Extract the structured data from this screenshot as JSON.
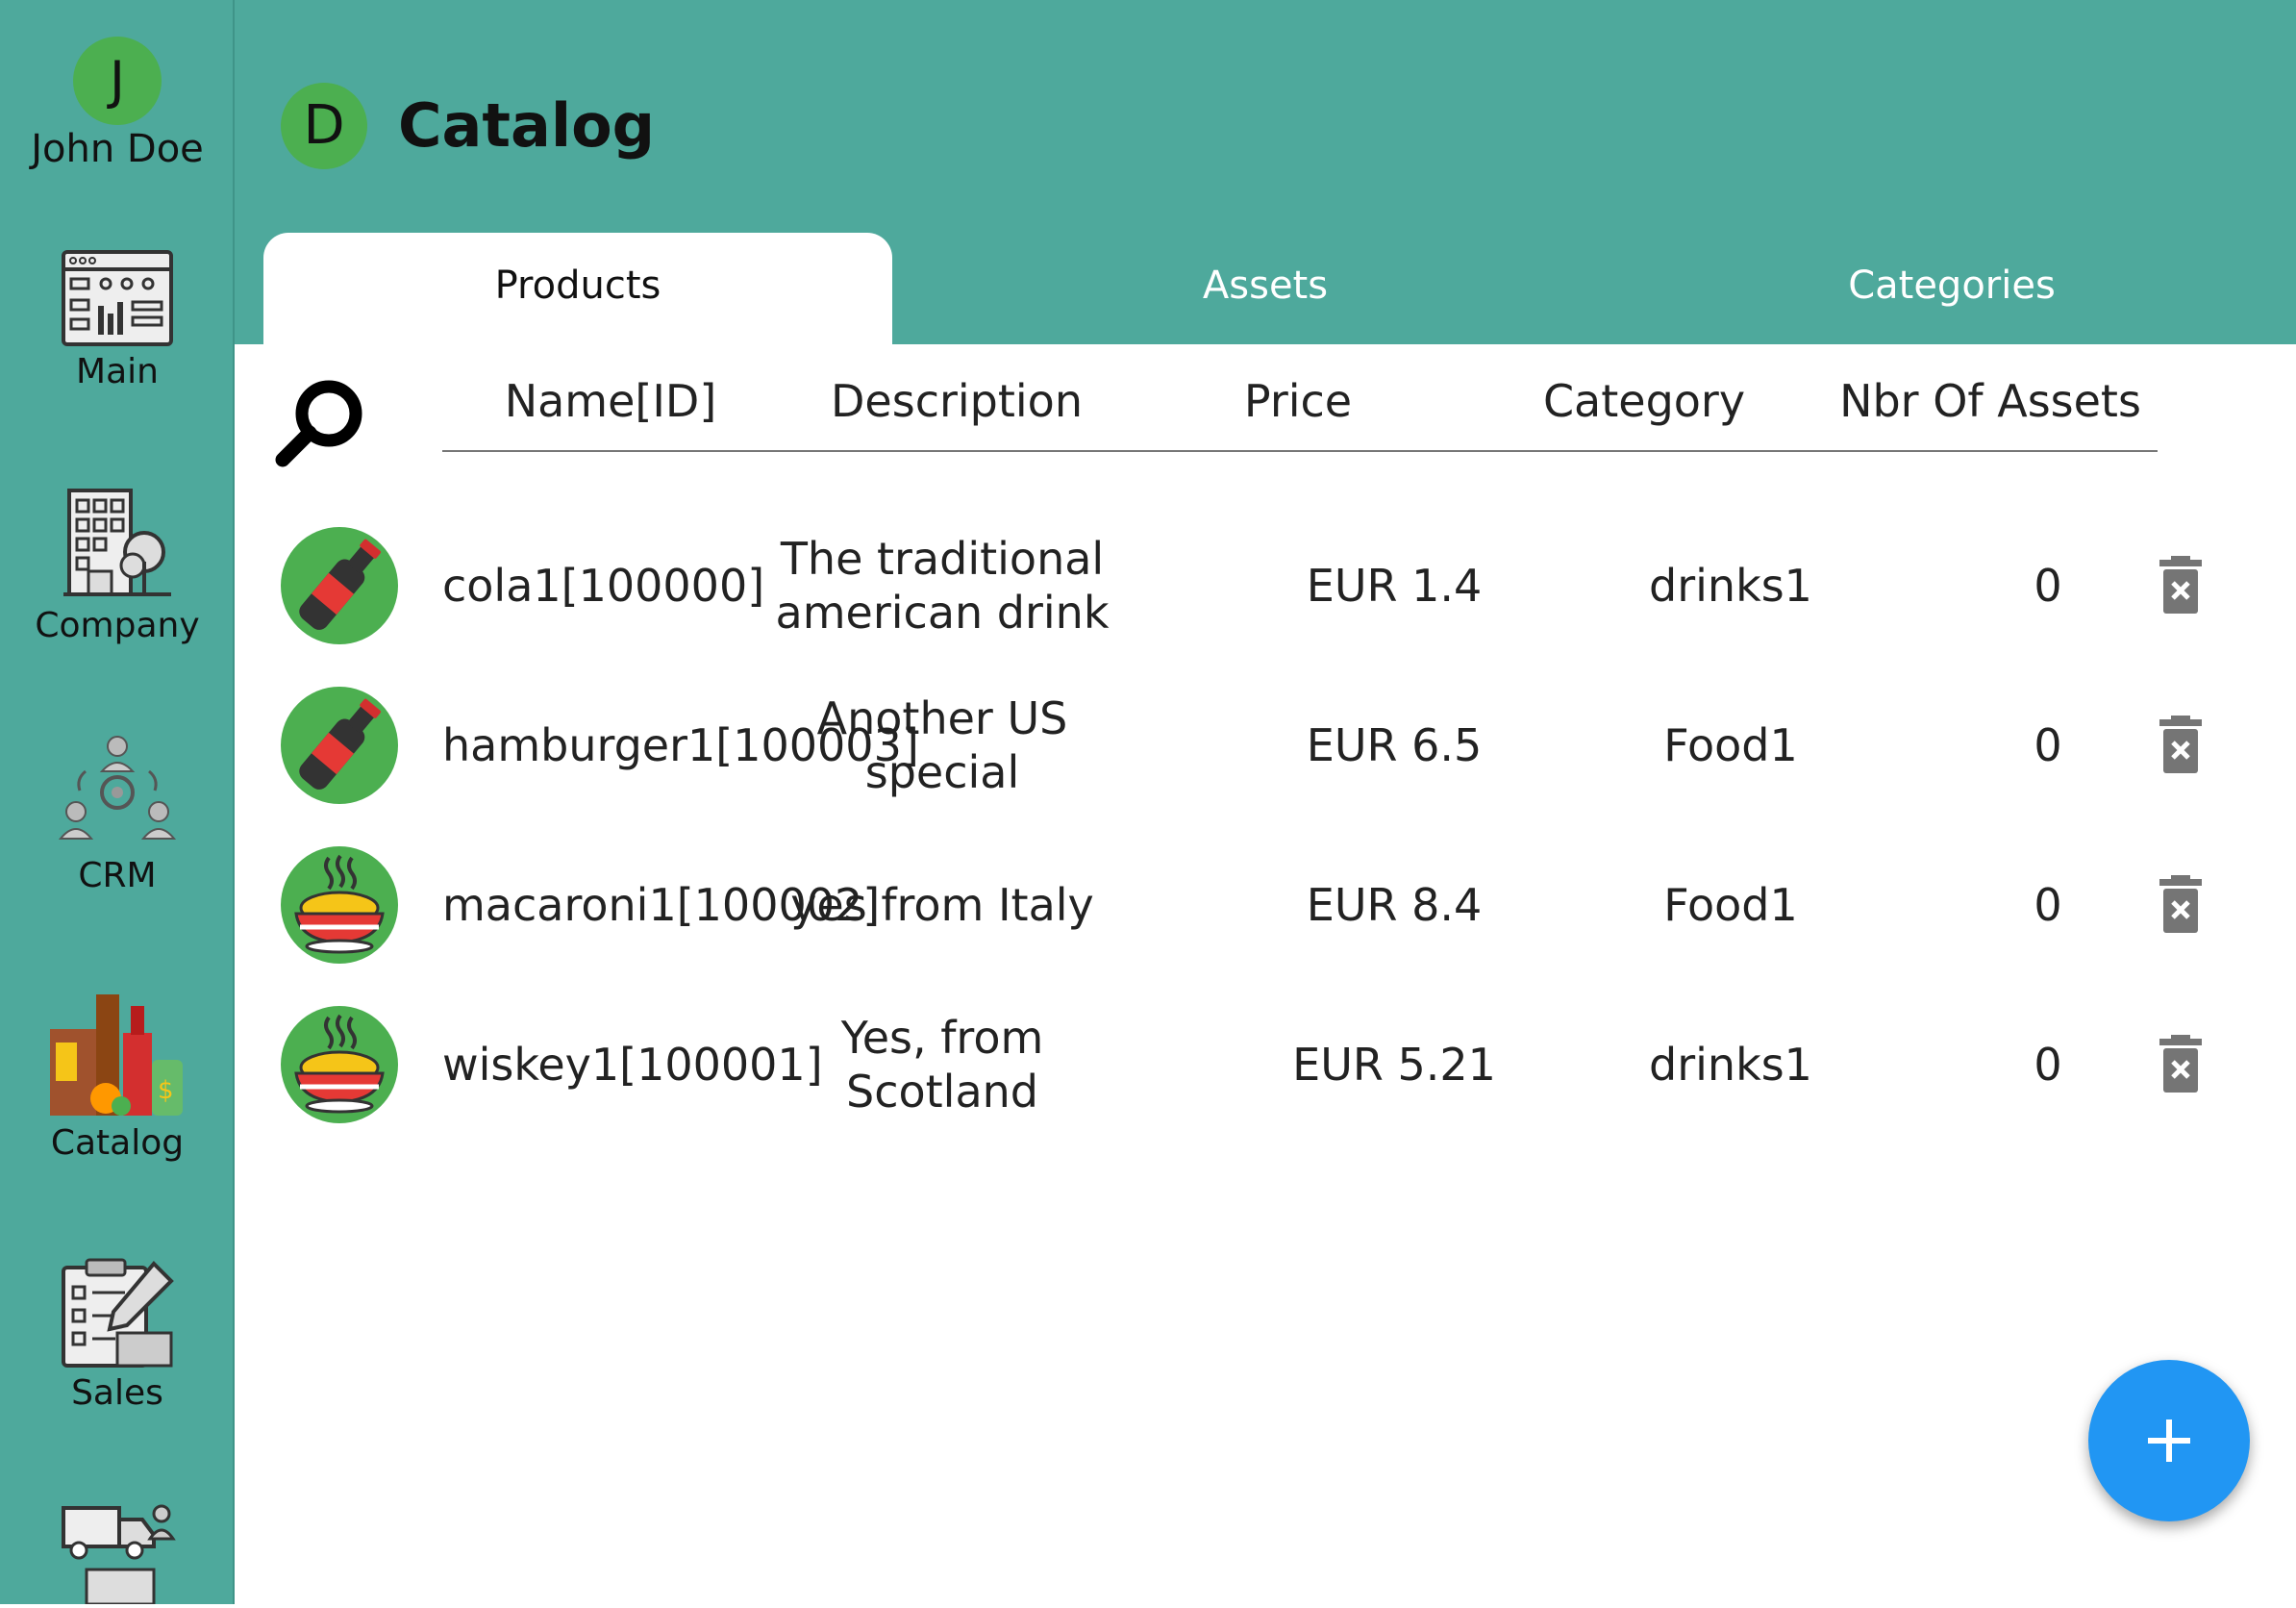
{
  "user": {
    "initial": "J",
    "name": "John Doe"
  },
  "nav": [
    {
      "label": "Main",
      "icon": "dashboard-icon"
    },
    {
      "label": "Company",
      "icon": "company-building-icon"
    },
    {
      "label": "CRM",
      "icon": "crm-people-icon"
    },
    {
      "label": "Catalog",
      "icon": "catalog-products-icon"
    },
    {
      "label": "Sales",
      "icon": "sales-clipboard-icon"
    },
    {
      "label": "",
      "icon": "logistics-truck-icon"
    }
  ],
  "header": {
    "initial": "D",
    "title": "Catalog"
  },
  "tabs": [
    {
      "label": "Products",
      "active": true
    },
    {
      "label": "Assets",
      "active": false
    },
    {
      "label": "Categories",
      "active": false
    }
  ],
  "table": {
    "columns": [
      "Name[ID]",
      "Description",
      "Price",
      "Category",
      "Nbr Of Assets"
    ],
    "rows": [
      {
        "name": "cola1[100000]",
        "description": "The traditional american drink",
        "price": "EUR 1.4",
        "category": "drinks1",
        "assets": "0",
        "icon": "cola-bottle-icon"
      },
      {
        "name": "hamburger1[100003]",
        "description": "Another US special",
        "price": "EUR 6.5",
        "category": "Food1",
        "assets": "0",
        "icon": "cola-bottle-icon"
      },
      {
        "name": "macaroni1[100002]",
        "description": "yes from Italy",
        "price": "EUR 8.4",
        "category": "Food1",
        "assets": "0",
        "icon": "noodle-bowl-icon"
      },
      {
        "name": "wiskey1[100001]",
        "description": "Yes, from Scotland",
        "price": "EUR 5.21",
        "category": "drinks1",
        "assets": "0",
        "icon": "noodle-bowl-icon"
      }
    ]
  },
  "colors": {
    "teal": "#4ea99c",
    "avatar_green": "#4caf50",
    "fab_blue": "#2196f3",
    "trash_gray": "#757575"
  }
}
